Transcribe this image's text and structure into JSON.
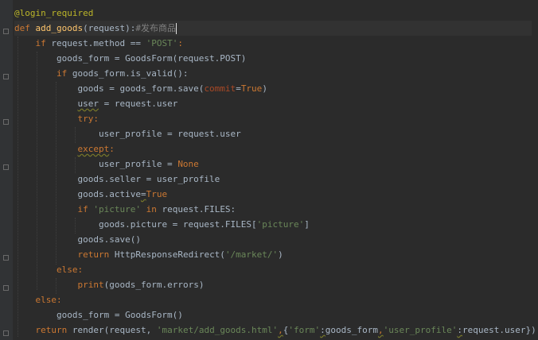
{
  "code": {
    "decorator": "@login_required",
    "def_kw": "def",
    "func_name": "add_goods",
    "params": "(request):",
    "comment": "#发布商品",
    "if_kw": "if",
    "request_method": " request.method == ",
    "post_str": "'POST'",
    "colon": ":",
    "form_post": "goods_form = GoodsForm(request.POST)",
    "if_valid": " goods_form.is_valid():",
    "goods_save_a": "goods = goods_form.save(",
    "commit_kwarg": "commit",
    "eq": "=",
    "true_kw": "True",
    "close_paren": ")",
    "user_var": "user",
    "user_assign": " = request.user",
    "try_kw": "try",
    "profile_assign": "user_profile = request.user",
    "except_kw": "except",
    "profile_none_a": "user_profile = ",
    "none_kw": "None",
    "seller_line": "goods.seller = user_profile",
    "active_a": "goods.active",
    "picture_str": "'picture'",
    "in_kw": "in",
    "files_tail": " request.FILES:",
    "pic_assign_a": "goods.picture = request.FILES[",
    "pic_close": "]",
    "goods_save2": "goods.save()",
    "return_kw": "return",
    "redirect_a": " HttpResponseRedirect(",
    "market_str": "'/market/'",
    "else_kw": "else",
    "print_kw": "print",
    "print_tail": "(goods_form.errors)",
    "form_empty": "goods_form = GoodsForm()",
    "render_a": " render(request, ",
    "template_str": "'market/add_goods.html'",
    "comma": ",",
    "brace_open": "{",
    "form_key": "'form'",
    "colon2": ":",
    "goods_form_ref": "goods_form",
    "profile_key": "'user_profile'",
    "render_tail": "request.user})"
  }
}
